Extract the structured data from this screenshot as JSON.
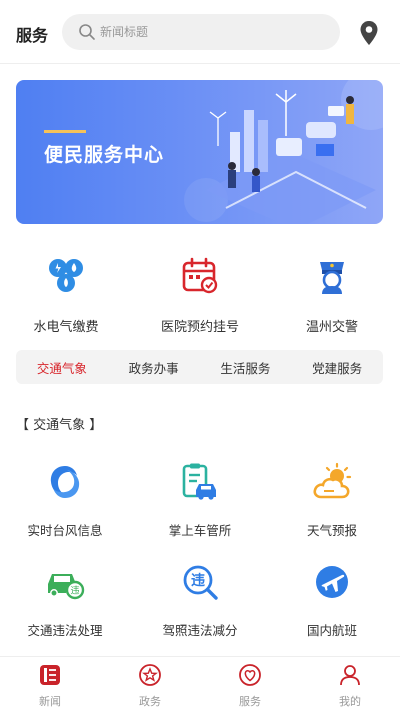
{
  "header": {
    "title": "服务",
    "search_placeholder": "新闻标题",
    "search_value": ""
  },
  "banner": {
    "text": "便民服务中心"
  },
  "quick_services": [
    {
      "label": "水电气缴费",
      "icon": "utilities-icon",
      "color": "#2f8de4"
    },
    {
      "label": "医院预约挂号",
      "icon": "calendar-check-icon",
      "color": "#d8262c"
    },
    {
      "label": "温州交警",
      "icon": "traffic-police-icon",
      "color": "#2f6fd6"
    }
  ],
  "tabs": [
    {
      "label": "交通气象",
      "active": true
    },
    {
      "label": "政务办事",
      "active": false
    },
    {
      "label": "生活服务",
      "active": false
    },
    {
      "label": "党建服务",
      "active": false
    }
  ],
  "section": {
    "title": "【 交通气象 】"
  },
  "grid": [
    {
      "label": "实时台风信息",
      "icon": "typhoon-icon",
      "color": "#2f7de4"
    },
    {
      "label": "掌上车管所",
      "icon": "car-clipboard-icon",
      "color": "#2bb2a0"
    },
    {
      "label": "天气预报",
      "icon": "weather-icon",
      "color": "#f4a72a"
    },
    {
      "label": "交通违法处理",
      "icon": "car-violation-icon",
      "color": "#3cae5a"
    },
    {
      "label": "驾照违法减分",
      "icon": "license-search-icon",
      "color": "#2f7de4"
    },
    {
      "label": "国内航班",
      "icon": "airplane-icon",
      "color": "#2f7de4"
    }
  ],
  "bottom_nav": [
    {
      "label": "新闻",
      "icon": "news-icon",
      "active": true
    },
    {
      "label": "政务",
      "icon": "star-badge-icon",
      "active": false
    },
    {
      "label": "服务",
      "icon": "heart-badge-icon",
      "active": false
    },
    {
      "label": "我的",
      "icon": "user-icon",
      "active": false
    }
  ],
  "colors": {
    "accent": "#d8262c",
    "banner_start": "#4f7ff2",
    "banner_end": "#8fa6f7"
  }
}
